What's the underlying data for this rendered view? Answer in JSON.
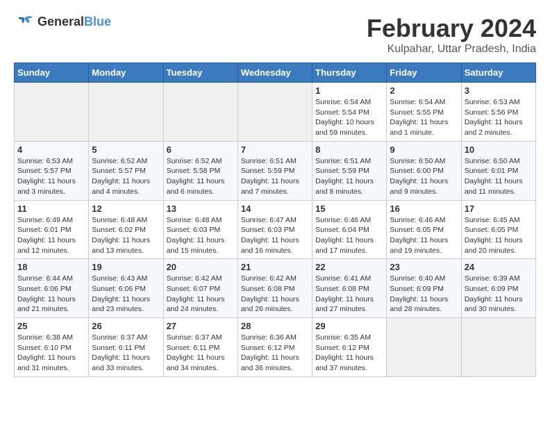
{
  "header": {
    "logo_text_general": "General",
    "logo_text_blue": "Blue",
    "month_title": "February 2024",
    "subtitle": "Kulpahar, Uttar Pradesh, India"
  },
  "weekdays": [
    "Sunday",
    "Monday",
    "Tuesday",
    "Wednesday",
    "Thursday",
    "Friday",
    "Saturday"
  ],
  "weeks": [
    [
      {
        "day": "",
        "empty": true
      },
      {
        "day": "",
        "empty": true
      },
      {
        "day": "",
        "empty": true
      },
      {
        "day": "",
        "empty": true
      },
      {
        "day": "1",
        "sunrise": "6:54 AM",
        "sunset": "5:54 PM",
        "daylight": "10 hours and 59 minutes."
      },
      {
        "day": "2",
        "sunrise": "6:54 AM",
        "sunset": "5:55 PM",
        "daylight": "11 hours and 1 minute."
      },
      {
        "day": "3",
        "sunrise": "6:53 AM",
        "sunset": "5:56 PM",
        "daylight": "11 hours and 2 minutes."
      }
    ],
    [
      {
        "day": "4",
        "sunrise": "6:53 AM",
        "sunset": "5:57 PM",
        "daylight": "11 hours and 3 minutes."
      },
      {
        "day": "5",
        "sunrise": "6:52 AM",
        "sunset": "5:57 PM",
        "daylight": "11 hours and 4 minutes."
      },
      {
        "day": "6",
        "sunrise": "6:52 AM",
        "sunset": "5:58 PM",
        "daylight": "11 hours and 6 minutes."
      },
      {
        "day": "7",
        "sunrise": "6:51 AM",
        "sunset": "5:59 PM",
        "daylight": "11 hours and 7 minutes."
      },
      {
        "day": "8",
        "sunrise": "6:51 AM",
        "sunset": "5:59 PM",
        "daylight": "11 hours and 8 minutes."
      },
      {
        "day": "9",
        "sunrise": "6:50 AM",
        "sunset": "6:00 PM",
        "daylight": "11 hours and 9 minutes."
      },
      {
        "day": "10",
        "sunrise": "6:50 AM",
        "sunset": "6:01 PM",
        "daylight": "11 hours and 11 minutes."
      }
    ],
    [
      {
        "day": "11",
        "sunrise": "6:49 AM",
        "sunset": "6:01 PM",
        "daylight": "11 hours and 12 minutes."
      },
      {
        "day": "12",
        "sunrise": "6:48 AM",
        "sunset": "6:02 PM",
        "daylight": "11 hours and 13 minutes."
      },
      {
        "day": "13",
        "sunrise": "6:48 AM",
        "sunset": "6:03 PM",
        "daylight": "11 hours and 15 minutes."
      },
      {
        "day": "14",
        "sunrise": "6:47 AM",
        "sunset": "6:03 PM",
        "daylight": "11 hours and 16 minutes."
      },
      {
        "day": "15",
        "sunrise": "6:46 AM",
        "sunset": "6:04 PM",
        "daylight": "11 hours and 17 minutes."
      },
      {
        "day": "16",
        "sunrise": "6:46 AM",
        "sunset": "6:05 PM",
        "daylight": "11 hours and 19 minutes."
      },
      {
        "day": "17",
        "sunrise": "6:45 AM",
        "sunset": "6:05 PM",
        "daylight": "11 hours and 20 minutes."
      }
    ],
    [
      {
        "day": "18",
        "sunrise": "6:44 AM",
        "sunset": "6:06 PM",
        "daylight": "11 hours and 21 minutes."
      },
      {
        "day": "19",
        "sunrise": "6:43 AM",
        "sunset": "6:06 PM",
        "daylight": "11 hours and 23 minutes."
      },
      {
        "day": "20",
        "sunrise": "6:42 AM",
        "sunset": "6:07 PM",
        "daylight": "11 hours and 24 minutes."
      },
      {
        "day": "21",
        "sunrise": "6:42 AM",
        "sunset": "6:08 PM",
        "daylight": "11 hours and 26 minutes."
      },
      {
        "day": "22",
        "sunrise": "6:41 AM",
        "sunset": "6:08 PM",
        "daylight": "11 hours and 27 minutes."
      },
      {
        "day": "23",
        "sunrise": "6:40 AM",
        "sunset": "6:09 PM",
        "daylight": "11 hours and 28 minutes."
      },
      {
        "day": "24",
        "sunrise": "6:39 AM",
        "sunset": "6:09 PM",
        "daylight": "11 hours and 30 minutes."
      }
    ],
    [
      {
        "day": "25",
        "sunrise": "6:38 AM",
        "sunset": "6:10 PM",
        "daylight": "11 hours and 31 minutes."
      },
      {
        "day": "26",
        "sunrise": "6:37 AM",
        "sunset": "6:11 PM",
        "daylight": "11 hours and 33 minutes."
      },
      {
        "day": "27",
        "sunrise": "6:37 AM",
        "sunset": "6:11 PM",
        "daylight": "11 hours and 34 minutes."
      },
      {
        "day": "28",
        "sunrise": "6:36 AM",
        "sunset": "6:12 PM",
        "daylight": "11 hours and 36 minutes."
      },
      {
        "day": "29",
        "sunrise": "6:35 AM",
        "sunset": "6:12 PM",
        "daylight": "11 hours and 37 minutes."
      },
      {
        "day": "",
        "empty": true
      },
      {
        "day": "",
        "empty": true
      }
    ]
  ]
}
